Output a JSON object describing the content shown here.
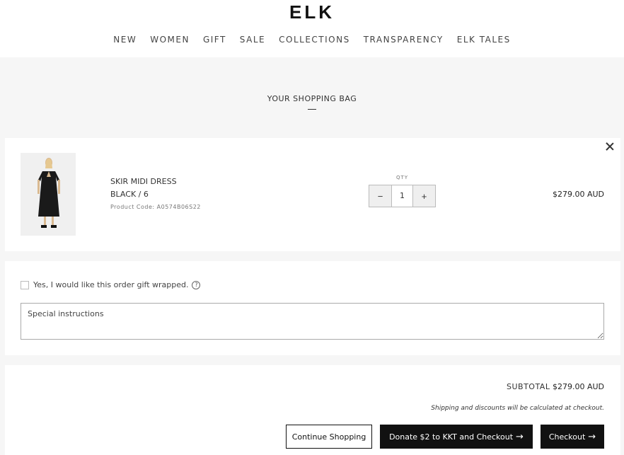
{
  "header": {
    "logo": "ELK",
    "nav": [
      "NEW",
      "WOMEN",
      "GIFT",
      "SALE",
      "COLLECTIONS",
      "TRANSPARENCY",
      "ELK TALES"
    ]
  },
  "bag": {
    "title": "YOUR SHOPPING BAG"
  },
  "item": {
    "name": "SKIR MIDI DRESS",
    "variant": "BLACK / 6",
    "code": "Product Code: A0574B06S22",
    "qty_label": "QTY",
    "qty": "1",
    "minus": "−",
    "plus": "+",
    "price": "$279.00 AUD"
  },
  "gift": {
    "label": "Yes, I would like this order gift wrapped.",
    "help": "?",
    "instructions_placeholder": "Special instructions"
  },
  "summary": {
    "subtotal_label": "SUBTOTAL",
    "subtotal_value": "$279.00 AUD",
    "shipping_note": "Shipping and discounts will be calculated at checkout.",
    "continue_label": "Continue Shopping",
    "donate_label": "Donate $2 to KKT and Checkout",
    "checkout_label": "Checkout",
    "arrow": "→"
  }
}
